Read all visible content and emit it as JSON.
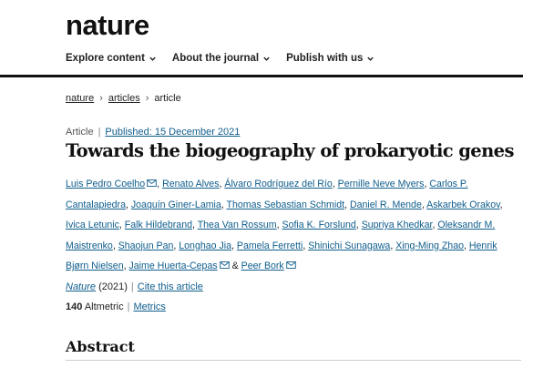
{
  "header": {
    "logo": "nature",
    "nav": [
      {
        "label": "Explore content"
      },
      {
        "label": "About the journal"
      },
      {
        "label": "Publish with us"
      }
    ]
  },
  "breadcrumb": [
    "nature",
    "articles",
    "article"
  ],
  "article": {
    "type": "Article",
    "published": "Published: 15 December 2021",
    "title": "Towards the biogeography of prokaryotic genes",
    "authors": [
      "Luis Pedro Coelho",
      "Renato Alves",
      "Álvaro Rodríguez del Río",
      "Pernille Neve Myers",
      "Carlos P. Cantalapiedra",
      "Joaquín Giner-Lamia",
      "Thomas Sebastian Schmidt",
      "Daniel R. Mende",
      "Askarbek Orakov",
      "Ivica Letunic",
      "Falk Hildebrand",
      "Thea Van Rossum",
      "Sofia K. Forslund",
      "Supriya Khedkar",
      "Oleksandr M. Maistrenko",
      "Shaojun Pan",
      "Longhao Jia",
      "Pamela Ferretti",
      "Shinichi Sunagawa",
      "Xing-Ming Zhao",
      "Henrik Bjørn Nielsen",
      "Jaime Huerta-Cepas",
      "Peer Bork"
    ],
    "author_joiner": "&",
    "journal": "Nature",
    "year": "(2021)",
    "cite": "Cite this article",
    "altmetric_count": "140",
    "altmetric_label": "Altmetric",
    "metrics_link": "Metrics",
    "abstract_heading": "Abstract"
  },
  "colors": {
    "link": "#0f5d8c",
    "rule": "#111111"
  }
}
